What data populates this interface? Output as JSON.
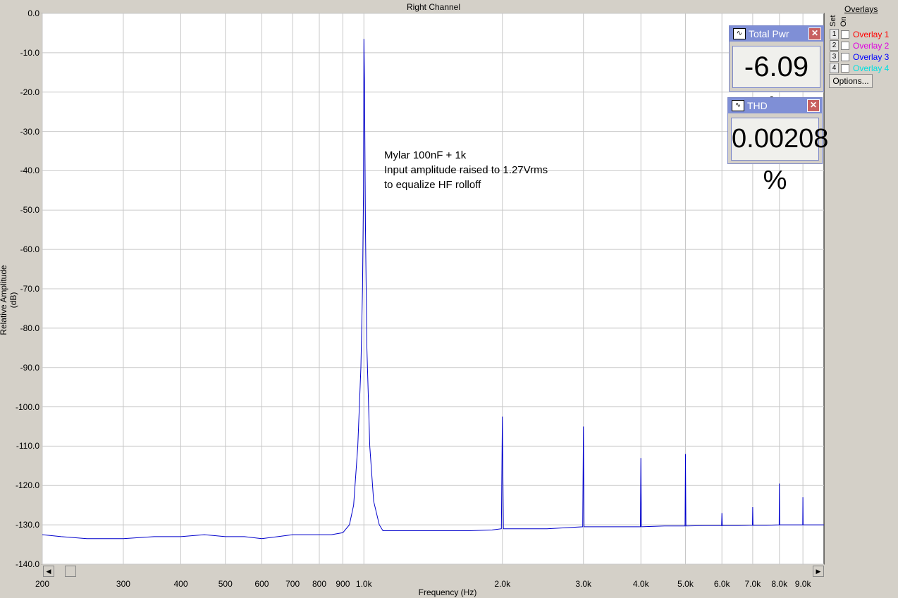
{
  "window": {
    "title": "Right Channel"
  },
  "meters": [
    {
      "label": "Total Pwr",
      "value": "-6.09 dB"
    },
    {
      "label": "THD",
      "value": "0.00208 %"
    }
  ],
  "overlays": {
    "header": "Overlays",
    "set_label": "Set",
    "on_label": "On",
    "items": [
      {
        "num": "1",
        "label": "Overlay 1",
        "color": "#ff0000",
        "checked": false
      },
      {
        "num": "2",
        "label": "Overlay 2",
        "color": "#e000e0",
        "checked": false
      },
      {
        "num": "3",
        "label": "Overlay 3",
        "color": "#0000ff",
        "checked": false
      },
      {
        "num": "4",
        "label": "Overlay 4",
        "color": "#00e0e0",
        "checked": false
      }
    ],
    "options_label": "Options..."
  },
  "annotation": {
    "lines": [
      "Mylar 100nF + 1k",
      "Input amplitude raised to 1.27Vrms",
      "to equalize HF rolloff"
    ]
  },
  "chart_data": {
    "type": "line",
    "title": "Right Channel",
    "xlabel": "Frequency (Hz)",
    "ylabel": "Relative Amplitude (dB)",
    "x_scale": "log",
    "xlim": [
      200,
      10000
    ],
    "ylim": [
      -140,
      0
    ],
    "grid": true,
    "line_color": "#0000cc",
    "x_ticks": [
      {
        "v": 200,
        "label": "200"
      },
      {
        "v": 300,
        "label": "300"
      },
      {
        "v": 400,
        "label": "400"
      },
      {
        "v": 500,
        "label": "500"
      },
      {
        "v": 600,
        "label": "600"
      },
      {
        "v": 700,
        "label": "700"
      },
      {
        "v": 800,
        "label": "800"
      },
      {
        "v": 900,
        "label": "900"
      },
      {
        "v": 1000,
        "label": "1.0k"
      },
      {
        "v": 2000,
        "label": "2.0k"
      },
      {
        "v": 3000,
        "label": "3.0k"
      },
      {
        "v": 4000,
        "label": "4.0k"
      },
      {
        "v": 5000,
        "label": "5.0k"
      },
      {
        "v": 6000,
        "label": "6.0k"
      },
      {
        "v": 7000,
        "label": "7.0k"
      },
      {
        "v": 8000,
        "label": "8.0k"
      },
      {
        "v": 9000,
        "label": "9.0k"
      }
    ],
    "y_ticks": [
      {
        "v": 0,
        "label": "0.0"
      },
      {
        "v": -10,
        "label": "-10.0"
      },
      {
        "v": -20,
        "label": "-20.0"
      },
      {
        "v": -30,
        "label": "-30.0"
      },
      {
        "v": -40,
        "label": "-40.0"
      },
      {
        "v": -50,
        "label": "-50.0"
      },
      {
        "v": -60,
        "label": "-60.0"
      },
      {
        "v": -70,
        "label": "-70.0"
      },
      {
        "v": -80,
        "label": "-80.0"
      },
      {
        "v": -90,
        "label": "-90.0"
      },
      {
        "v": -100,
        "label": "-100.0"
      },
      {
        "v": -110,
        "label": "-110.0"
      },
      {
        "v": -120,
        "label": "-120.0"
      },
      {
        "v": -130,
        "label": "-130.0"
      },
      {
        "v": -140,
        "label": "-140.0"
      }
    ],
    "series": [
      {
        "points": [
          [
            200,
            -132.5
          ],
          [
            220,
            -133
          ],
          [
            250,
            -133.5
          ],
          [
            300,
            -133.5
          ],
          [
            350,
            -133
          ],
          [
            400,
            -133
          ],
          [
            450,
            -132.5
          ],
          [
            500,
            -133
          ],
          [
            550,
            -133
          ],
          [
            600,
            -133.5
          ],
          [
            650,
            -133
          ],
          [
            700,
            -132.5
          ],
          [
            750,
            -132.5
          ],
          [
            800,
            -132.5
          ],
          [
            850,
            -132.5
          ],
          [
            900,
            -132
          ],
          [
            930,
            -130
          ],
          [
            950,
            -125
          ],
          [
            970,
            -110
          ],
          [
            985,
            -90
          ],
          [
            993,
            -70
          ],
          [
            998,
            -45
          ],
          [
            1000,
            -6.5
          ],
          [
            1003,
            -17
          ],
          [
            1008,
            -55
          ],
          [
            1015,
            -85
          ],
          [
            1030,
            -110
          ],
          [
            1050,
            -124
          ],
          [
            1080,
            -130
          ],
          [
            1100,
            -131.5
          ],
          [
            1150,
            -131.5
          ],
          [
            1200,
            -131.5
          ],
          [
            1300,
            -131.5
          ],
          [
            1500,
            -131.5
          ],
          [
            1700,
            -131.5
          ],
          [
            1900,
            -131.3
          ],
          [
            1990,
            -131
          ],
          [
            2000,
            -102.5
          ],
          [
            2010,
            -131
          ],
          [
            2500,
            -131
          ],
          [
            2990,
            -130.5
          ],
          [
            3000,
            -105
          ],
          [
            3010,
            -130.5
          ],
          [
            3500,
            -130.5
          ],
          [
            3990,
            -130.5
          ],
          [
            4000,
            -113
          ],
          [
            4010,
            -130.5
          ],
          [
            4500,
            -130.3
          ],
          [
            4990,
            -130.3
          ],
          [
            5000,
            -112
          ],
          [
            5010,
            -130.3
          ],
          [
            5500,
            -130.2
          ],
          [
            5990,
            -130.2
          ],
          [
            6000,
            -127
          ],
          [
            6010,
            -130.2
          ],
          [
            6500,
            -130.2
          ],
          [
            6990,
            -130.1
          ],
          [
            7000,
            -125.5
          ],
          [
            7010,
            -130.1
          ],
          [
            7500,
            -130.1
          ],
          [
            7990,
            -130
          ],
          [
            8000,
            -119.5
          ],
          [
            8010,
            -130
          ],
          [
            8500,
            -130
          ],
          [
            8990,
            -130
          ],
          [
            9000,
            -123
          ],
          [
            9010,
            -130
          ],
          [
            9500,
            -130
          ],
          [
            10000,
            -130
          ]
        ]
      }
    ]
  }
}
